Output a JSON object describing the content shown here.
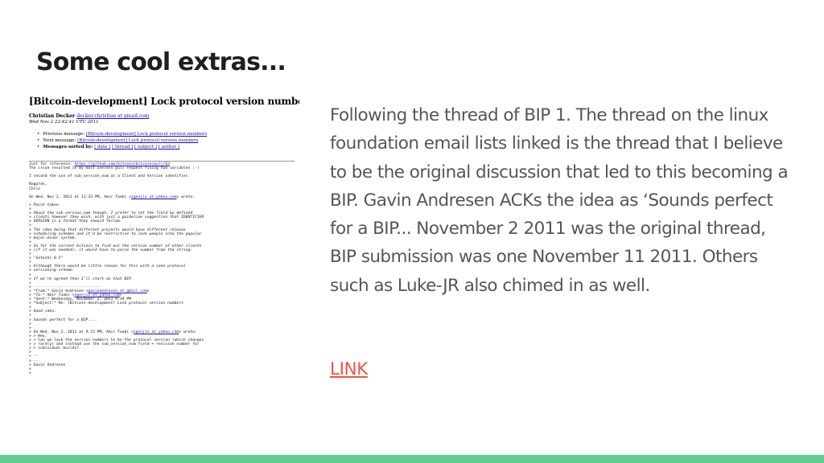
{
  "slide": {
    "title": "Some cool extras...",
    "description": "Following the thread of BIP 1. The thread on the linux foundation email lists  linked is the thread that I believe to be the original discussion that led to this becoming a BIP. Gavin Andresen ACKs the idea as ‘Sounds perfect for a BIP... November 2 2011 was the original thread, BIP submission was one November 11 2011. Others such as Luke-JR also chimed in as well.",
    "link_label": "LINK",
    "accent_bar_color": "#5ecf8f",
    "link_color": "#ef5446"
  },
  "email": {
    "subject": "[Bitcoin-development] Lock protocol version numbers",
    "author": "Christian Decker",
    "author_address": "decker.christian at gmail.com",
    "date": "Wed Nov 2 22:42:41 UTC 2011",
    "nav": [
      {
        "prefix": "Previous message: ",
        "link": "[Bitcoin-development] Lock protocol version numbers"
      },
      {
        "prefix": "Next message: ",
        "link": "[Bitcoin-development] Lock protocol version numbers"
      }
    ],
    "sorted_by_label": "Messages sorted by:",
    "sort_links": [
      "[ date ]",
      "[ thread ]",
      "[ subject ]",
      "[ author ]"
    ],
    "body": {
      "reference_prefix": "Just for reference: ",
      "reference_link": "https://github.com/bitcoin/bitcoin/pull/63",
      "line_issue": "The issue resulted in my most useless pull request fixing two variables :-)",
      "line_second": "I second the use of sub_version_num as a Client and Version identifier.",
      "regards": "Regards,",
      "signature": "Chris",
      "quote_header_prefix": "On Wed, Nov 2, 2011 at 11:33 PM, Amir Taaki <",
      "quote_header_link": "zgenjix at yahoo.com",
      "quote_header_suffix": "> wrote:",
      "q1": "> Point taken.",
      "q2": "> About the sub_version_num though. I prefer to let the field by defined",
      "q3": "> clients however they wish, with just a guideline suggestion that IDENTIFIER",
      "q4": "> VERSION is a format they should follow.",
      "q5": "> The idea being that different projects would have different release",
      "q6": "> scheduling schemes and it'd be restrictive to lock people into the popular",
      "q7": "> major.minor system.",
      "q8": "> So for the current bitcoin to find out the version number of other clients",
      "q9": "> (if it was needed), it would have to parse the number from the string:",
      "q10": "> \"Satoshi 0.5\"",
      "q11": "> Although there would be little reason for this with a sane protocol",
      "q12": "> versioning scheme.",
      "q13": "> If we're agreed then I'll start on that BIP.",
      "q14": "> ------------------------------",
      "from_prefix": "> *From:* Gavin Andresen <",
      "from_link": "gavinandresen at gmail.com",
      "to_prefix": "> *To:* Amir Taaki <",
      "to_link": "zgenjix at yahoo.com",
      "sent": "> *Sent:* Wednesday, November 2, 2011 9:34 PM",
      "subject_line": "> *Subject:* Re: [Bitcoin-development] Lock protocol version numbers",
      "q15": "> Good idea.",
      "q16": "> Sounds perfect for a BIP....",
      "inner_header_prefix": "> On Wed, Nov 2, 2011 at 9:23 PM, Amir Taaki <",
      "inner_header_link": "zgenjix at yahoo.com",
      "inner_header_suffix": "> wrote:",
      "q17": "> > Hey,",
      "q18": "> > Can we lock the version numbers to be the protocol version (which changes",
      "q19": "> > rarely) and instead use the sub_version_num field + revision number for",
      "q20": "> > individual builds?",
      "q21": "> --",
      "q22": "> --",
      "q23": "> Gavin Andresen"
    }
  }
}
